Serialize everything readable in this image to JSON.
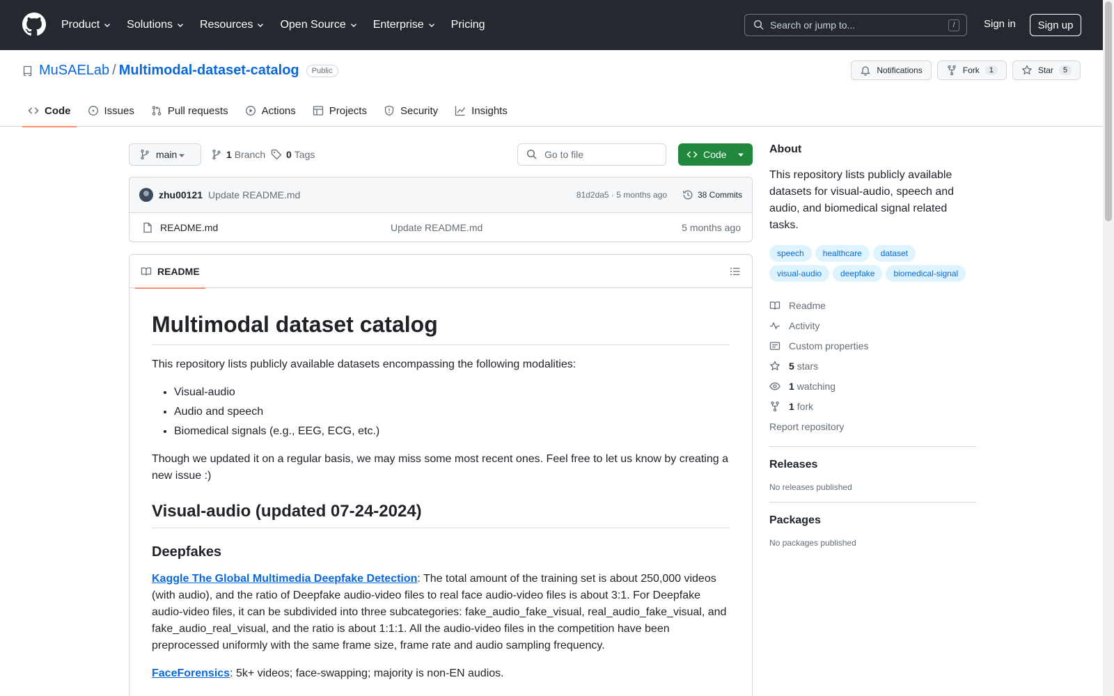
{
  "header": {
    "nav": [
      "Product",
      "Solutions",
      "Resources",
      "Open Source",
      "Enterprise",
      "Pricing"
    ],
    "search_placeholder": "Search or jump to...",
    "search_shortcut": "/",
    "signin": "Sign in",
    "signup": "Sign up"
  },
  "repo": {
    "owner": "MuSAELab",
    "separator": "/",
    "name": "Multimodal-dataset-catalog",
    "visibility": "Public",
    "notifications_label": "Notifications",
    "fork_label": "Fork",
    "fork_count": "1",
    "star_label": "Star",
    "star_count": "5"
  },
  "tabs": [
    "Code",
    "Issues",
    "Pull requests",
    "Actions",
    "Projects",
    "Security",
    "Insights"
  ],
  "toolbar": {
    "branch": "main",
    "branch_count": "1",
    "branch_label": "Branch",
    "tag_count": "0",
    "tag_label": "Tags",
    "goto_placeholder": "Go to file",
    "code_button": "Code"
  },
  "commit": {
    "author": "zhu00121",
    "message": "Update README.md",
    "meta": "81d2da5 · 5 months ago",
    "commits": "38 Commits"
  },
  "files": [
    {
      "name": "README.md",
      "message": "Update README.md",
      "date": "5 months ago"
    }
  ],
  "readme": {
    "tab_label": "README",
    "title": "Multimodal dataset catalog",
    "intro": "This repository lists publicly available datasets encompassing the following modalities:",
    "modalities": [
      "Visual-audio",
      "Audio and speech",
      "Biomedical signals (e.g., EEG, ECG, etc.)"
    ],
    "note": "Though we updated it on a regular basis, we may miss some most recent ones. Feel free to let us know by creating a new issue :)",
    "section_title": "Visual-audio (updated 07-24-2024)",
    "subsection_title": "Deepfakes",
    "item1_link": "Kaggle The Global Multimedia Deepfake Detection",
    "item1_text": ": The total amount of the training set is about 250,000 videos (with audio), and the ratio of Deepfake audio-video files to real face audio-video files is about 3:1. For Deepfake audio-video files, it can be subdivided into three subcategories: fake_audio_fake_visual, real_audio_fake_visual, and fake_audio_real_visual, and the ratio is about 1:1:1. All the audio-video files in the competition have been preprocessed uniformly with the same frame size, frame rate and audio sampling frequency.",
    "item2_link": "FaceForensics",
    "item2_text": ": 5k+ videos; face-swapping; majority is non-EN audios."
  },
  "sidebar": {
    "about_title": "About",
    "about_text": "This repository lists publicly available datasets for visual-audio, speech and audio, and biomedical signal related tasks.",
    "topics": [
      "speech",
      "healthcare",
      "dataset",
      "visual-audio",
      "deepfake",
      "biomedical-signal"
    ],
    "readme": "Readme",
    "activity": "Activity",
    "custom_properties": "Custom properties",
    "stars_count": "5",
    "stars_label": "stars",
    "watching_count": "1",
    "watching_label": "watching",
    "fork_count": "1",
    "fork_label": "fork",
    "report": "Report repository",
    "releases_title": "Releases",
    "releases_text": "No releases published",
    "packages_title": "Packages",
    "packages_text": "No packages published"
  },
  "colors": {
    "header_bg": "#24292f",
    "link": "#0969da",
    "code_button": "#1f883d",
    "tab_underline": "#fd8c73",
    "topic_bg": "#ddf4ff"
  }
}
